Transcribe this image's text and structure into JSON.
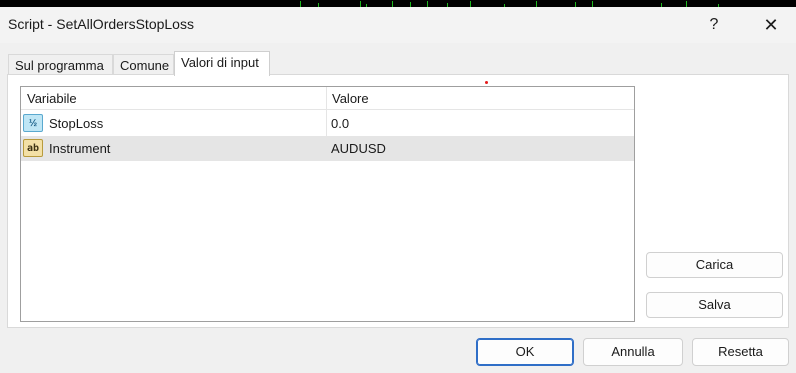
{
  "window": {
    "title": "Script - SetAllOrdersStopLoss",
    "help_label": "?",
    "close_label": "✕"
  },
  "tabs": [
    {
      "label": "Sul programma",
      "active": false
    },
    {
      "label": "Comune",
      "active": false
    },
    {
      "label": "Valori di input",
      "active": true
    }
  ],
  "table": {
    "columns": [
      "Variabile",
      "Valore"
    ],
    "rows": [
      {
        "icon": "numeric-value-icon",
        "icon_text": "½",
        "name": "StopLoss",
        "value": "0.0",
        "selected": false
      },
      {
        "icon": "string-value-icon",
        "icon_text": "ab",
        "name": "Instrument",
        "value": "AUDUSD",
        "selected": true
      }
    ]
  },
  "side_buttons": {
    "load": "Carica",
    "save": "Salva"
  },
  "footer_buttons": {
    "ok": "OK",
    "cancel": "Annulla",
    "reset": "Resetta"
  },
  "colors": {
    "selected_row": "#e5e5e5",
    "primary_border": "#2f6ec7",
    "chart_candles": "#1db51d"
  }
}
